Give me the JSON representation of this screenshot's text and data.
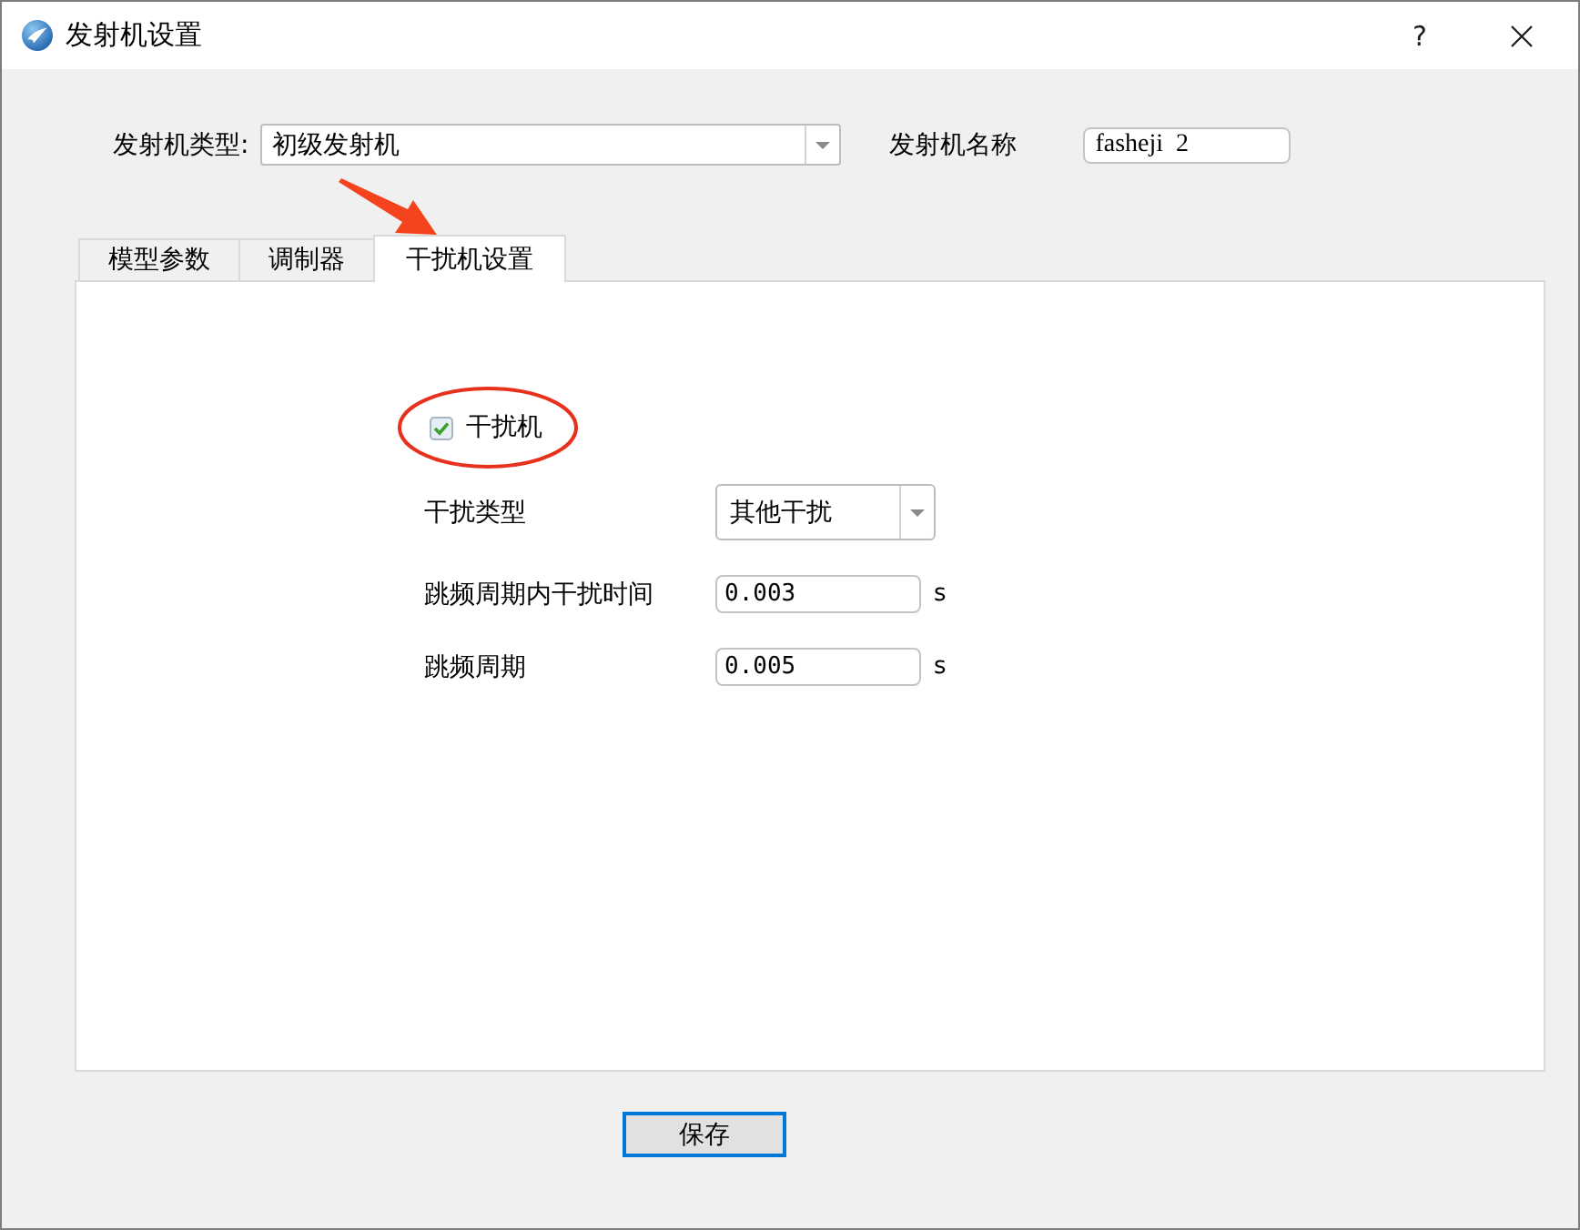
{
  "window": {
    "title": "发射机设置",
    "help": "?"
  },
  "transmitter_type": {
    "label": "发射机类型:",
    "value": "初级发射机"
  },
  "transmitter_name": {
    "label": "发射机名称",
    "value": "fasheji  2"
  },
  "tabs": [
    {
      "label": "模型参数",
      "selected": false
    },
    {
      "label": "调制器",
      "selected": false
    },
    {
      "label": "干扰机设置",
      "selected": true
    }
  ],
  "jammer": {
    "enabled": {
      "label": "干扰机",
      "checked": true
    },
    "fields": [
      {
        "kind": "select",
        "label": "干扰类型",
        "value": "其他干扰"
      },
      {
        "kind": "input",
        "label": "跳频周期内干扰时间",
        "value": "0.003",
        "unit": "s"
      },
      {
        "kind": "input",
        "label": "跳频周期",
        "value": "0.005",
        "unit": "s"
      }
    ]
  },
  "save_button": "保存"
}
